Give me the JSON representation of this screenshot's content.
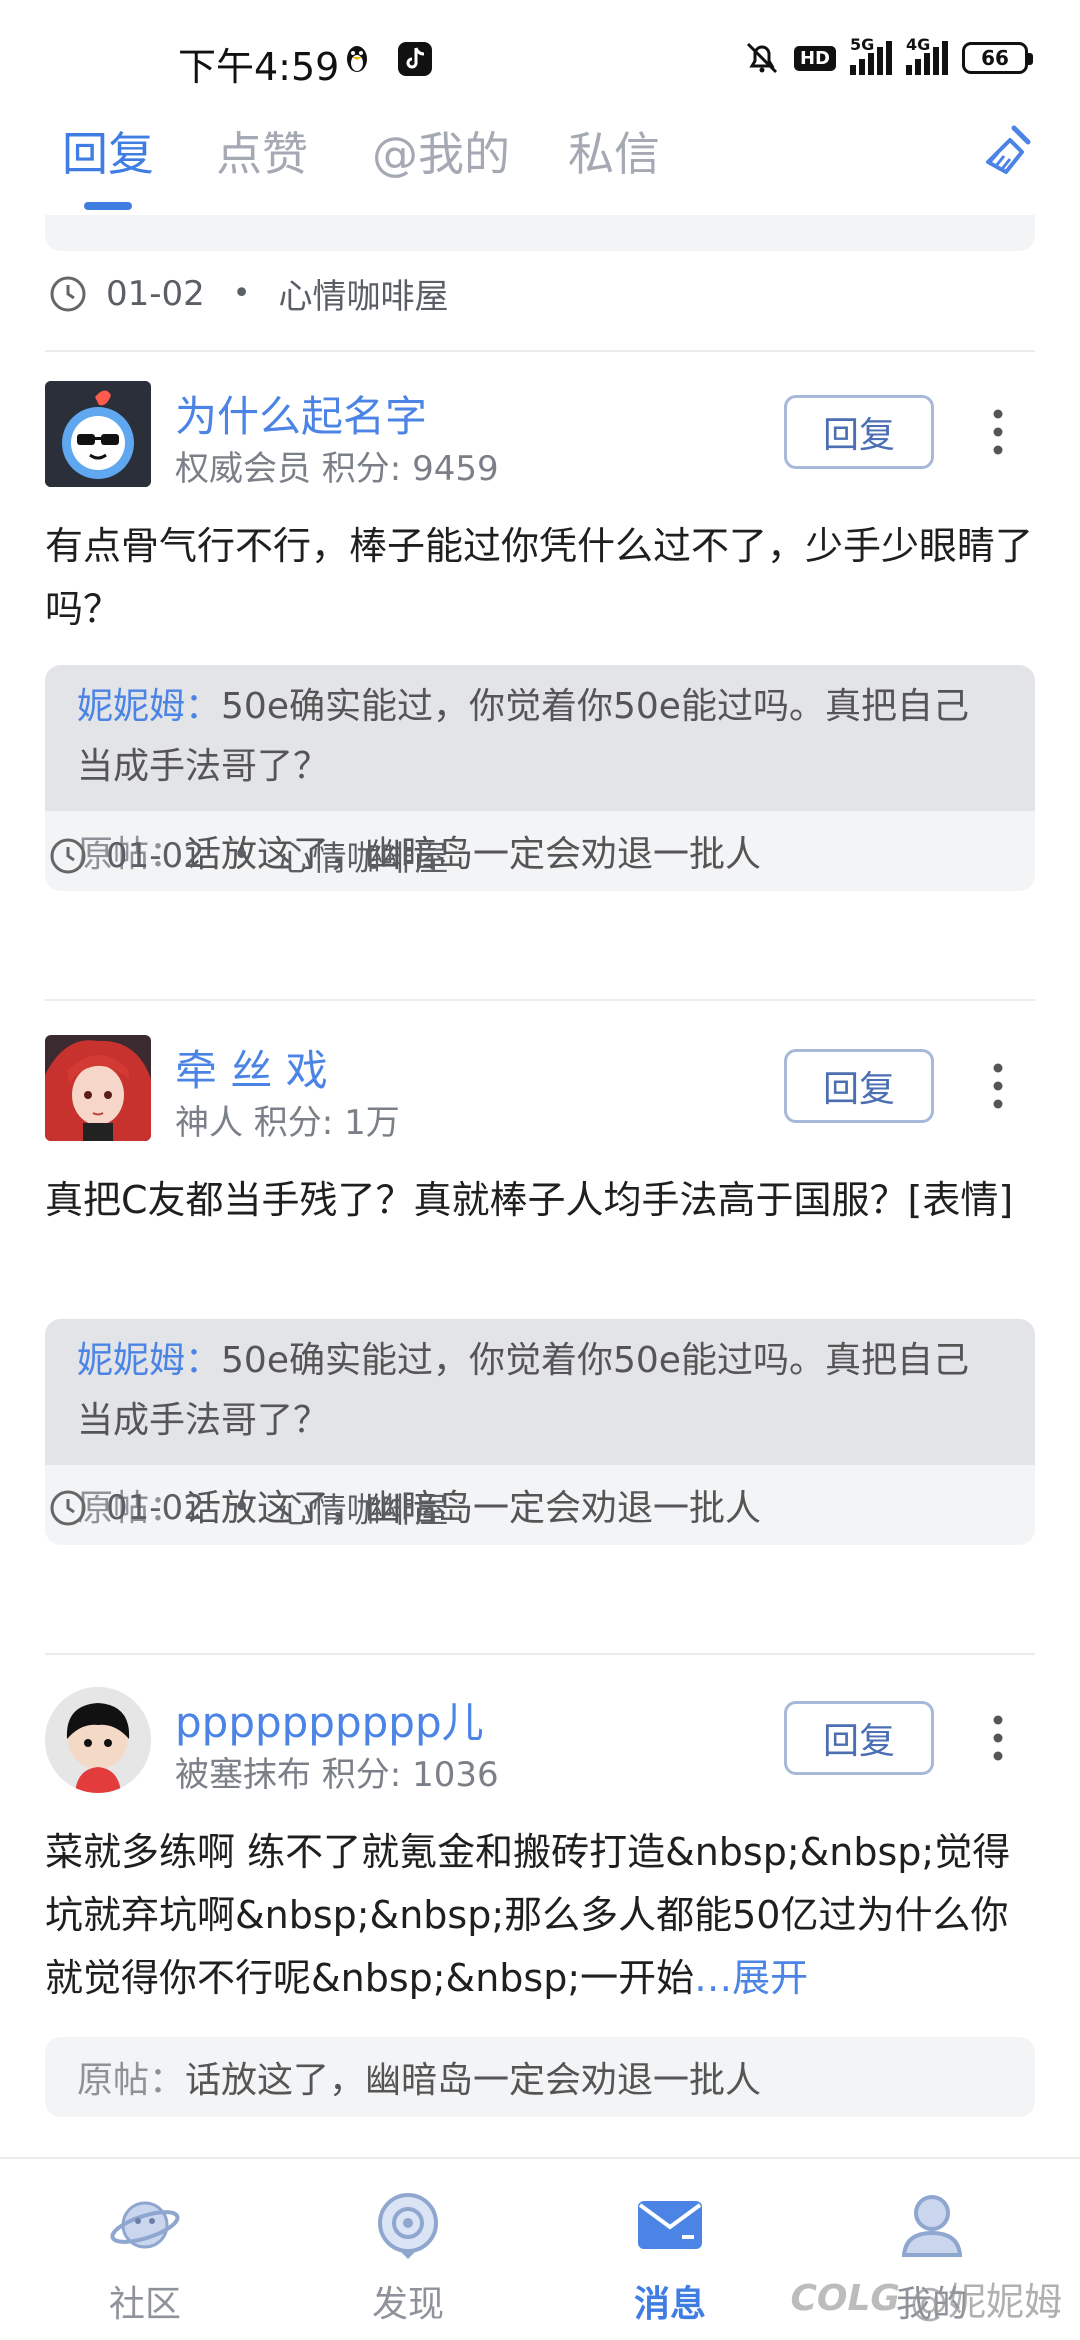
{
  "status_bar": {
    "time": "下午4:59",
    "hd_label": "HD",
    "net1": "5G",
    "net2": "4G",
    "battery": "66"
  },
  "tabs": [
    {
      "label": "回复",
      "active": true
    },
    {
      "label": "点赞",
      "active": false
    },
    {
      "label": "@我的",
      "active": false
    },
    {
      "label": "私信",
      "active": false
    }
  ],
  "top_meta": {
    "date": "01-02",
    "forum": "心情咖啡屋"
  },
  "posts": [
    {
      "username": "为什么起名字",
      "userinfo": "权威会员  积分: 9459",
      "reply_label": "回复",
      "content": "有点骨气行不行，棒子能过你凭什么过不了，少手少眼睛了吗？",
      "quote_name": "妮妮姆",
      "quote_text": "50e确实能过，你觉着你50e能过吗。真把自己当成手法哥了？",
      "orig_label": "原帖：",
      "orig_text": "话放这了，幽暗岛一定会劝退一批人",
      "date": "01-02",
      "forum": "心情咖啡屋"
    },
    {
      "username": "牵 丝 戏",
      "userinfo": "神人  积分: 1万",
      "reply_label": "回复",
      "content": "真把C友都当手残了？真就棒子人均手法高于国服？[表情]",
      "quote_name": "妮妮姆",
      "quote_text": "50e确实能过，你觉着你50e能过吗。真把自己当成手法哥了？",
      "orig_label": "原帖：",
      "orig_text": "话放这了，幽暗岛一定会劝退一批人",
      "date": "01-02",
      "forum": "心情咖啡屋"
    },
    {
      "username": "pppppppppp儿",
      "userinfo": "被塞抹布  积分: 1036",
      "reply_label": "回复",
      "content": "菜就多练啊 练不了就氪金和搬砖打造&nbsp;&nbsp;觉得坑就弃坑啊&nbsp;&nbsp;那么多人都能50亿过为什么你就觉得你不行呢&nbsp;&nbsp;一开始",
      "expand_label": "…展开",
      "orig_label": "原帖：",
      "orig_text": "话放这了，幽暗岛一定会劝退一批人"
    }
  ],
  "bottom_nav": [
    {
      "label": "社区",
      "icon": "planet-icon",
      "active": false
    },
    {
      "label": "发现",
      "icon": "discover-icon",
      "active": false
    },
    {
      "label": "消息",
      "icon": "message-icon",
      "active": true
    },
    {
      "label": "我的",
      "icon": "profile-icon",
      "active": false
    }
  ],
  "watermark": {
    "logo": "COLG",
    "text": "@妮妮姆"
  },
  "colors": {
    "accent": "#3f7de3",
    "link": "#4b84e4"
  }
}
